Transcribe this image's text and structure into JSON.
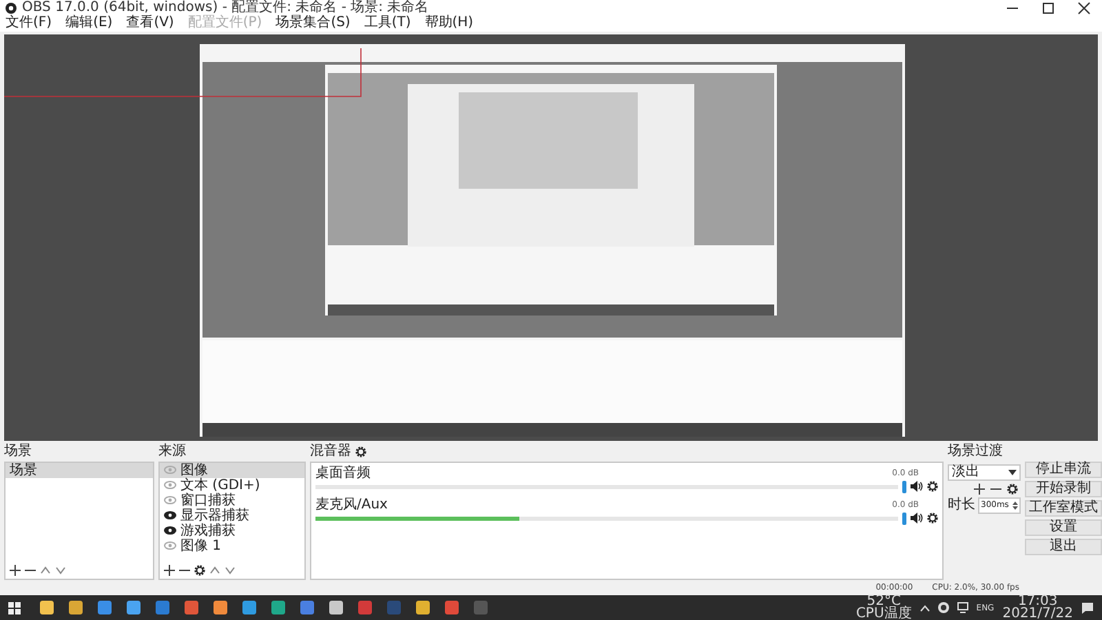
{
  "window": {
    "title": "OBS 17.0.0 (64bit, windows) - 配置文件: 未命名 - 场景: 未命名"
  },
  "menu": [
    {
      "label": "文件(F)",
      "disabled": false
    },
    {
      "label": "编辑(E)",
      "disabled": false
    },
    {
      "label": "查看(V)",
      "disabled": false
    },
    {
      "label": "配置文件(P)",
      "disabled": true
    },
    {
      "label": "场景集合(S)",
      "disabled": false
    },
    {
      "label": "工具(T)",
      "disabled": false
    },
    {
      "label": "帮助(H)",
      "disabled": false
    }
  ],
  "preview": {
    "kind": "picture"
  },
  "scenes": {
    "title": "场景",
    "items": [
      {
        "label": "场景",
        "selected": true
      }
    ]
  },
  "sources": {
    "title": "来源",
    "items": [
      {
        "label": "图像",
        "visible": false,
        "selected": true
      },
      {
        "label": "文本 (GDI+)",
        "visible": false,
        "selected": false
      },
      {
        "label": "窗口捕获",
        "visible": false,
        "selected": false
      },
      {
        "label": "显示器捕获",
        "visible": true,
        "selected": false
      },
      {
        "label": "游戏捕获",
        "visible": true,
        "selected": false
      },
      {
        "label": "图像 1",
        "visible": false,
        "selected": false
      }
    ]
  },
  "mixer": {
    "title": "混音器",
    "channels": [
      {
        "name": "桌面音频",
        "reading": "0.0 dB",
        "level": 0
      },
      {
        "name": "麦克风/Aux",
        "reading": "0.0 dB",
        "level": 0.35
      }
    ]
  },
  "transitions": {
    "title": "场景过渡",
    "selected": "淡出",
    "duration_label": "时长",
    "duration": "300ms"
  },
  "controls": [
    "停止串流",
    "开始录制",
    "工作室模式",
    "设置",
    "退出"
  ],
  "status_bar": {
    "time": "00:00:00",
    "cpu": "CPU: 2.0%, 30.00 fps"
  },
  "taskbar": {
    "apps": [
      {
        "color": "#f2c14e"
      },
      {
        "color": "#d9a635"
      },
      {
        "color": "#3a8ee6"
      },
      {
        "color": "#4aa3f0"
      },
      {
        "color": "#2b7bd1"
      },
      {
        "color": "#e0563a"
      },
      {
        "color": "#f08a3c"
      },
      {
        "color": "#2f9be0"
      },
      {
        "color": "#1fa88a"
      },
      {
        "color": "#4a7fe0"
      },
      {
        "color": "#c8c8c8"
      },
      {
        "color": "#d23a3a"
      },
      {
        "color": "#2a4a7a"
      },
      {
        "color": "#e0b030"
      },
      {
        "color": "#e04a3a"
      },
      {
        "color": "#555555"
      }
    ],
    "temp": "52°C",
    "temp_label": "CPU温度",
    "lang": "ENG",
    "clock": "17:03",
    "date": "2021/7/22"
  }
}
